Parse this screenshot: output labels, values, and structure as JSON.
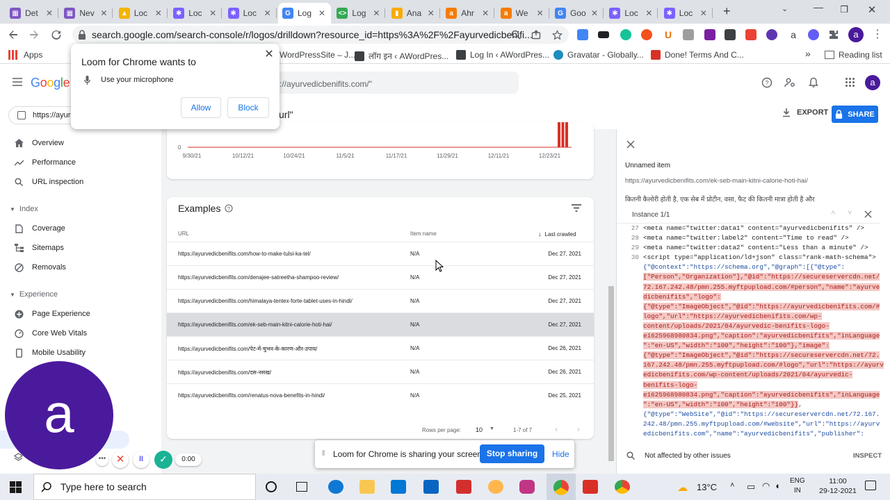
{
  "browser": {
    "tabs": [
      {
        "title": "Det",
        "color": "#7e57c2",
        "glyph": "▦"
      },
      {
        "title": "Nev",
        "color": "#7e57c2",
        "glyph": "▦"
      },
      {
        "title": "Loc",
        "color": "#f4b400",
        "glyph": "▲"
      },
      {
        "title": "Loc",
        "color": "#7b61ff",
        "glyph": "✱"
      },
      {
        "title": "Loc",
        "color": "#7b61ff",
        "glyph": "✱"
      },
      {
        "title": "Log",
        "color": "#4285f4",
        "glyph": "G"
      },
      {
        "title": "Log",
        "color": "#34a853",
        "glyph": "<>"
      },
      {
        "title": "Ana",
        "color": "#f9ab00",
        "glyph": "▮"
      },
      {
        "title": "Ahr",
        "color": "#f57c00",
        "glyph": "a"
      },
      {
        "title": "We",
        "color": "#f57c00",
        "glyph": "a"
      },
      {
        "title": "Goo",
        "color": "#4285f4",
        "glyph": "G"
      },
      {
        "title": "Loc",
        "color": "#7b61ff",
        "glyph": "✱"
      },
      {
        "title": "Loc",
        "color": "#7b61ff",
        "glyph": "✱"
      }
    ],
    "new_tab": "+",
    "url": "search.google.com/search-console/r/logos/drilldown?resource_id=https%3A%2F%2Fayurvedicbenifi...",
    "avatar_letter": "a",
    "bookmarks": {
      "apps": "Apps",
      "items": [
        "WordPressSite – J...",
        "लॉग इन ‹ AWordPres...",
        "Log In ‹ AWordPres...",
        "Gravatar - Globally...",
        "Done! Terms And C..."
      ],
      "more": "»",
      "reading_list": "Reading list"
    }
  },
  "permission_popup": {
    "title": "Loom for Chrome wants to",
    "item": "Use your microphone",
    "allow": "Allow",
    "block": "Block"
  },
  "gsc": {
    "logo": "Google",
    "search_text": "s://ayurvedicbenifits.com/\"",
    "property_label": "https://ayur",
    "subhead_fragment": "url\"",
    "export": "EXPORT",
    "share": "SHARE",
    "nav": {
      "top": [
        "Overview",
        "Performance",
        "URL inspection"
      ],
      "index_label": "Index",
      "index": [
        "Coverage",
        "Sitemaps",
        "Removals"
      ],
      "experience_label": "Experience",
      "experience": [
        "Page Experience",
        "Core Web Vitals",
        "Mobile Usability"
      ]
    }
  },
  "chart_data": {
    "type": "bar",
    "x_ticks": [
      "9/30/21",
      "10/12/21",
      "10/24/21",
      "11/5/21",
      "11/17/21",
      "11/29/21",
      "12/11/21",
      "12/23/21"
    ],
    "y_tick": "0",
    "bars_near_end": [
      1,
      1,
      1
    ]
  },
  "examples": {
    "title": "Examples",
    "col_url": "URL",
    "col_item": "Item name",
    "col_crawled": "Last crawled",
    "rows": [
      {
        "url": "https://ayurvedicbenifits.com/how-to-make-tulsi-ka-tel/",
        "item": "N/A",
        "date": "Dec 27, 2021"
      },
      {
        "url": "https://ayurvedicbenifits.com/denajee-satreetha-shampoo-review/",
        "item": "N/A",
        "date": "Dec 27, 2021"
      },
      {
        "url": "https://ayurvedicbenifits.com/himalaya-tentex-forte-tablet-uses-in-hindi/",
        "item": "N/A",
        "date": "Dec 27, 2021"
      },
      {
        "url": "https://ayurvedicbenifits.com/ek-seb-main-kitni-calorie-hoti-hai/",
        "item": "N/A",
        "date": "Dec 27, 2021"
      },
      {
        "url": "https://ayurvedicbenifits.com/पेट-में-चुभन-के-कारण-और-उपाय/",
        "item": "N/A",
        "date": "Dec 26, 2021"
      },
      {
        "url": "https://ayurvedicbenifits.com/दस-नसख/",
        "item": "N/A",
        "date": "Dec 26, 2021"
      },
      {
        "url": "https://ayurvedicbenifits.com/renatus-nova-benefits-in-hindi/",
        "item": "N/A",
        "date": "Dec 25, 2021"
      }
    ],
    "rows_per_page_label": "Rows per page:",
    "rows_per_page": "10",
    "range": "1-7 of 7"
  },
  "panel": {
    "item_title": "Unnamed item",
    "item_url": "https://ayurvedicbenifits.com/ek-seb-main-kitni-calorie-hoti-hai/",
    "hindi_snippet": "कितनी कैलोरी होती है, एक सेब में प्रोटीन, वसा, फैट की कितनी मात्रा होती है और",
    "instance": "Instance 1/1",
    "footer": "Not affected by other issues",
    "inspect": "INSPECT"
  },
  "sharebar": {
    "text": "Loom for Chrome is sharing your screen.",
    "stop": "Stop sharing",
    "hide": "Hide"
  },
  "loom": {
    "avatar_letter": "a",
    "timer": "0:00"
  },
  "taskbar": {
    "search_placeholder": "Type here to search",
    "weather": "13°C",
    "lang1": "ENG",
    "lang2": "IN",
    "time": "11:00",
    "date": "29-12-2021"
  },
  "colors": {
    "accent": "#1a73e8",
    "loom_purple": "#625df5",
    "loom_avatar": "#4a1a9c",
    "highlight": "#f4c7c3",
    "chart_bar": "#d93025"
  }
}
